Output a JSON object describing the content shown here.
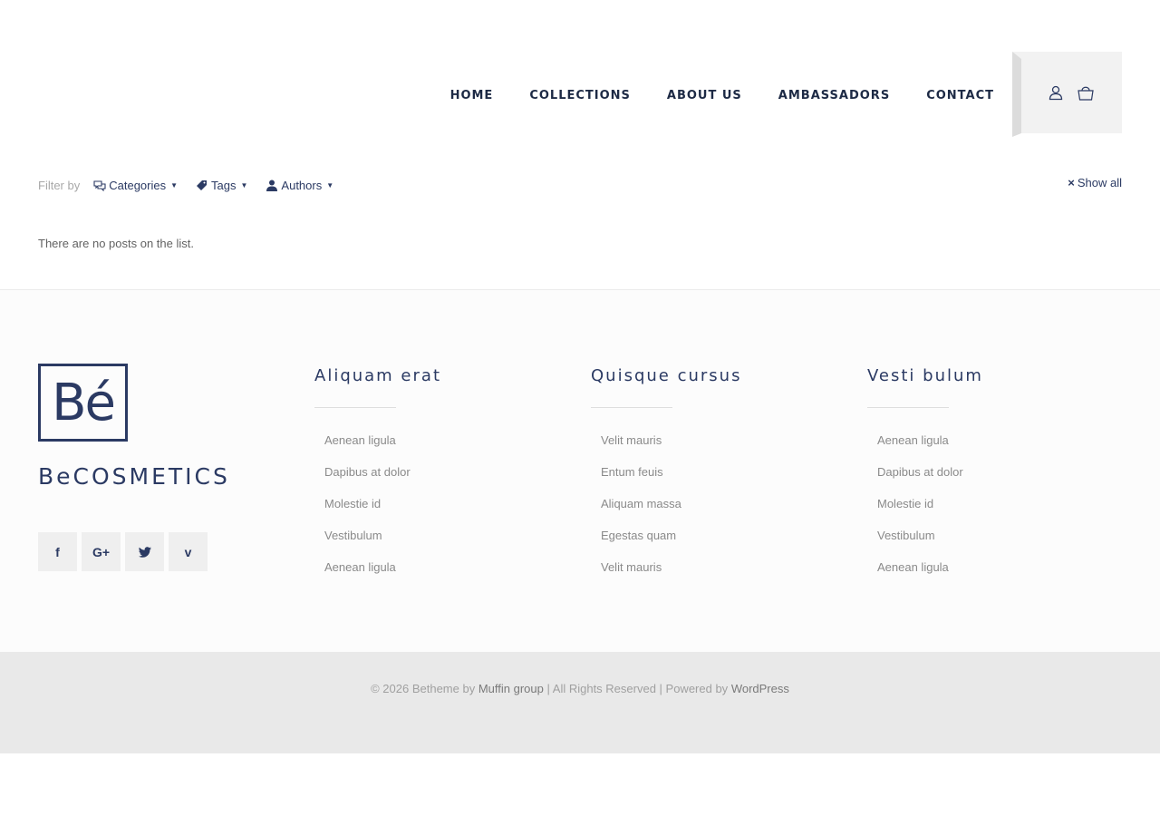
{
  "nav": {
    "items": [
      "HOME",
      "COLLECTIONS",
      "ABOUT US",
      "AMBASSADORS",
      "CONTACT"
    ]
  },
  "filters": {
    "label": "Filter by",
    "categories": "Categories",
    "tags": "Tags",
    "authors": "Authors",
    "show_all": "Show all"
  },
  "content": {
    "empty_message": "There are no posts on the list."
  },
  "footer": {
    "logo_mark": "Bé",
    "brand_name": "BeCOSMETICS",
    "columns": [
      {
        "title": "Aliquam erat",
        "links": [
          "Aenean ligula",
          "Dapibus at dolor",
          "Molestie id",
          "Vestibulum",
          "Aenean ligula"
        ]
      },
      {
        "title": "Quisque cursus",
        "links": [
          "Velit mauris",
          "Entum feuis",
          "Aliquam massa",
          "Egestas quam",
          "Velit mauris"
        ]
      },
      {
        "title": "Vesti bulum",
        "links": [
          "Aenean ligula",
          "Dapibus at dolor",
          "Molestie id",
          "Vestibulum",
          "Aenean ligula"
        ]
      }
    ],
    "socials": [
      {
        "icon": "facebook-icon",
        "glyph": "f"
      },
      {
        "icon": "google-plus-icon",
        "glyph": "G+"
      },
      {
        "icon": "twitter-icon",
        "glyph": ""
      },
      {
        "icon": "vimeo-icon",
        "glyph": "v"
      }
    ],
    "copyright": {
      "prefix": "© 2026 Betheme by",
      "author_link": "Muffin group",
      "middle": "| All Rights Reserved | Powered by",
      "platform_link": "WordPress"
    }
  },
  "colors": {
    "accent": "#2b3a63",
    "nav_text": "#1d2a45",
    "footer_bg": "#fcfcfc",
    "copyright_bg": "#e9e9e9"
  }
}
